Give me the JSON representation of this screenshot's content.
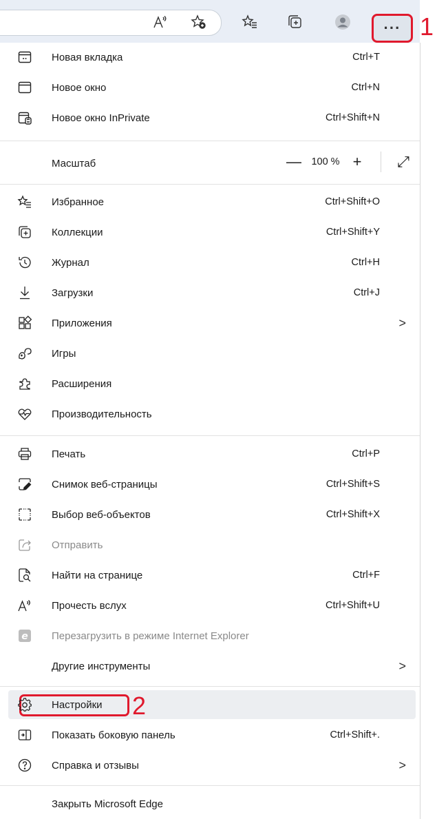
{
  "toolbar": {
    "icons": [
      "read-aloud-icon",
      "add-favorite-icon",
      "favorites-icon",
      "collections-icon",
      "profile-icon"
    ],
    "more_label": "···"
  },
  "callouts": {
    "one": "1",
    "two": "2"
  },
  "menu": {
    "new_tab": {
      "label": "Новая вкладка",
      "shortcut": "Ctrl+T"
    },
    "new_window": {
      "label": "Новое окно",
      "shortcut": "Ctrl+N"
    },
    "new_private": {
      "label": "Новое окно InPrivate",
      "shortcut": "Ctrl+Shift+N"
    },
    "zoom": {
      "label": "Масштаб",
      "minus": "—",
      "value": "100 %",
      "plus": "+",
      "fullscreen": "⤢"
    },
    "favorites": {
      "label": "Избранное",
      "shortcut": "Ctrl+Shift+O"
    },
    "collections": {
      "label": "Коллекции",
      "shortcut": "Ctrl+Shift+Y"
    },
    "history": {
      "label": "Журнал",
      "shortcut": "Ctrl+H"
    },
    "downloads": {
      "label": "Загрузки",
      "shortcut": "Ctrl+J"
    },
    "apps": {
      "label": "Приложения",
      "chevron": ">"
    },
    "games": {
      "label": "Игры"
    },
    "extensions": {
      "label": "Расширения"
    },
    "performance": {
      "label": "Производительность"
    },
    "print": {
      "label": "Печать",
      "shortcut": "Ctrl+P"
    },
    "screenshot": {
      "label": "Снимок веб-страницы",
      "shortcut": "Ctrl+Shift+S"
    },
    "web_select": {
      "label": "Выбор веб-объектов",
      "shortcut": "Ctrl+Shift+X"
    },
    "share": {
      "label": "Отправить"
    },
    "find": {
      "label": "Найти на странице",
      "shortcut": "Ctrl+F"
    },
    "read_aloud": {
      "label": "Прочесть вслух",
      "shortcut": "Ctrl+Shift+U"
    },
    "ie_mode": {
      "label": "Перезагрузить в режиме Internet Explorer"
    },
    "more_tools": {
      "label": "Другие инструменты",
      "chevron": ">"
    },
    "settings": {
      "label": "Настройки"
    },
    "sidebar": {
      "label": "Показать боковую панель",
      "shortcut": "Ctrl+Shift+."
    },
    "help": {
      "label": "Справка и отзывы",
      "chevron": ">"
    },
    "close": {
      "label": "Закрыть Microsoft Edge"
    }
  }
}
